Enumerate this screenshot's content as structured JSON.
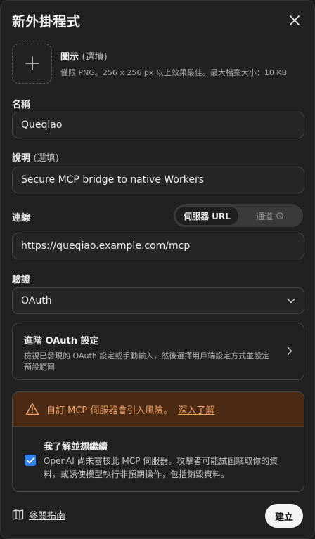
{
  "dialog": {
    "title": "新外掛程式"
  },
  "icon_field": {
    "label": "圖示",
    "optional": "(選填)",
    "hint": "僅限 PNG。256 x 256 px 以上效果最佳。最大檔案大小：10 KB"
  },
  "name_field": {
    "label": "名稱",
    "value": "Queqiao"
  },
  "description_field": {
    "label": "說明",
    "optional": "(選填)",
    "value": "Secure MCP bridge to native Workers"
  },
  "connection": {
    "label": "連線",
    "options": [
      "伺服器 URL",
      "通道"
    ],
    "selected": "伺服器 URL",
    "url": "https://queqiao.example.com/mcp"
  },
  "auth": {
    "label": "驗證",
    "value": "OAuth"
  },
  "advanced_oauth": {
    "title": "進階 OAuth 設定",
    "description": "檢視已發現的 OAuth 設定或手動輸入，然後選擇用戶端設定方式並設定預設範圍"
  },
  "warning": {
    "text": "自訂 MCP 伺服器會引入風險。",
    "link": "深入了解",
    "ack_title": "我了解並想繼續",
    "ack_desc": "OpenAI 尚未審核此 MCP 伺服器。攻擊者可能試圖竊取你的資料，或誘使模型執行非預期操作，包括銷毀資料。",
    "checked": true
  },
  "footer": {
    "guide_link": "參閱指南",
    "create_label": "建立"
  },
  "colors": {
    "background": "#212121",
    "warning_bg": "#4a2a12",
    "warning_text": "#f3a36b",
    "checkbox": "#2f81f7"
  },
  "icons": {
    "close": "close-icon",
    "upload": "plus-icon",
    "info": "info-icon",
    "select": "chevron-down-icon",
    "advanced": "chevron-right-icon",
    "warning": "warning-triangle-icon",
    "check": "check-icon",
    "guide": "book-icon"
  }
}
